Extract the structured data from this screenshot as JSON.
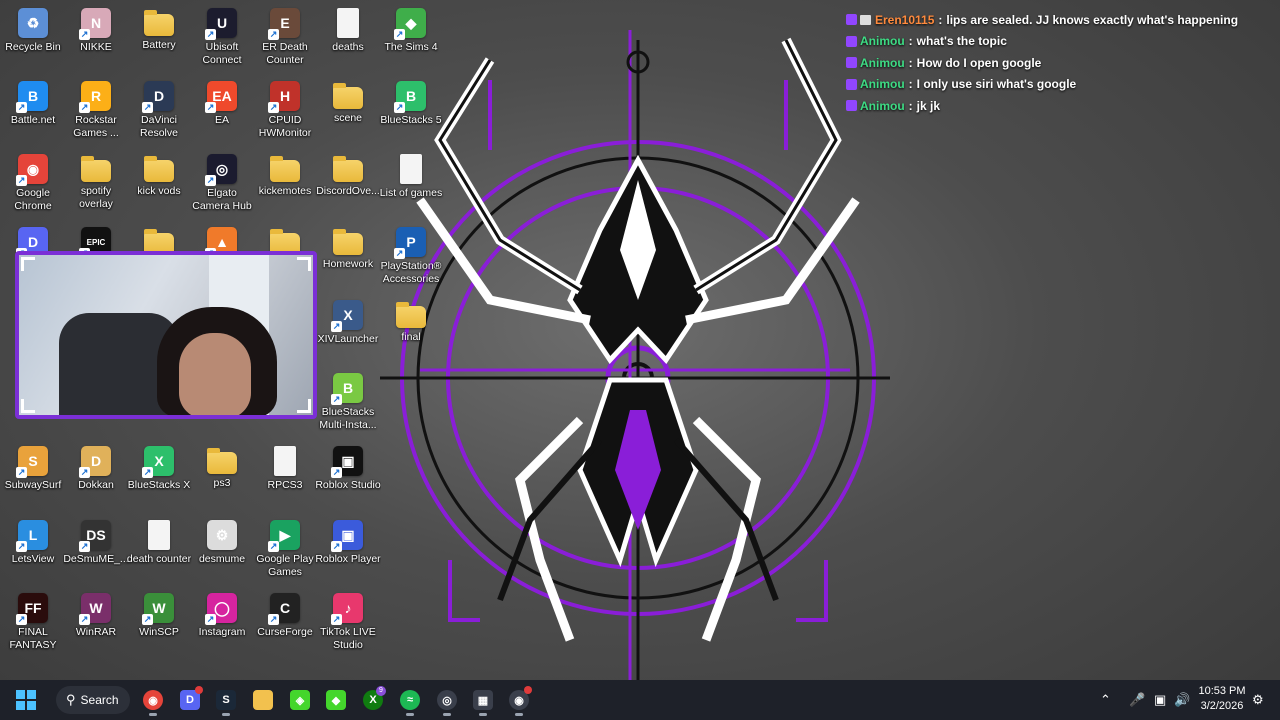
{
  "desktop_icons": [
    {
      "label": "Recycle Bin",
      "icon": "recycle-bin-icon"
    },
    {
      "label": "NIKKE",
      "icon": "nikke-icon"
    },
    {
      "label": "Battery",
      "icon": "folder-icon"
    },
    {
      "label": "Ubisoft Connect",
      "icon": "ubisoft-icon"
    },
    {
      "label": "ER Death Counter",
      "icon": "er-death-counter-icon"
    },
    {
      "label": "deaths",
      "icon": "document-icon"
    },
    {
      "label": "The Sims 4",
      "icon": "sims-icon"
    },
    {
      "label": "Battle.net",
      "icon": "battlenet-icon"
    },
    {
      "label": "Rockstar Games ...",
      "icon": "rockstar-icon"
    },
    {
      "label": "DaVinci Resolve",
      "icon": "davinci-icon"
    },
    {
      "label": "EA",
      "icon": "ea-icon"
    },
    {
      "label": "CPUID HWMonitor",
      "icon": "hwmonitor-icon"
    },
    {
      "label": "scene",
      "icon": "folder-icon"
    },
    {
      "label": "BlueStacks 5",
      "icon": "bluestacks-icon"
    },
    {
      "label": "Google Chrome",
      "icon": "chrome-icon"
    },
    {
      "label": "spotify overlay",
      "icon": "folder-icon"
    },
    {
      "label": "kick vods",
      "icon": "folder-icon"
    },
    {
      "label": "Elgato Camera Hub",
      "icon": "elgato-icon"
    },
    {
      "label": "kickemotes",
      "icon": "folder-icon"
    },
    {
      "label": "DiscordOve...",
      "icon": "folder-icon"
    },
    {
      "label": "List of games",
      "icon": "document-icon"
    },
    {
      "label": "",
      "icon": "discord-icon"
    },
    {
      "label": "",
      "icon": "epic-games-icon"
    },
    {
      "label": "",
      "icon": "folder-icon"
    },
    {
      "label": "",
      "icon": "app-icon"
    },
    {
      "label": "",
      "icon": "folder-icon"
    },
    {
      "label": "Homework",
      "icon": "folder-icon"
    },
    {
      "label": "PlayStation® Accessories",
      "icon": "playstation-icon"
    },
    {
      "label": "XIVLauncher",
      "icon": "xivlauncher-icon"
    },
    {
      "label": "final",
      "icon": "folder-icon"
    },
    {
      "label": "BlueStacks Multi-Insta...",
      "icon": "bluestacks-multi-icon"
    },
    {
      "label": "SubwaySurf",
      "icon": "subway-surfers-icon"
    },
    {
      "label": "Dokkan",
      "icon": "dokkan-icon"
    },
    {
      "label": "BlueStacks X",
      "icon": "bluestacks-x-icon"
    },
    {
      "label": "ps3",
      "icon": "folder-icon"
    },
    {
      "label": "RPCS3",
      "icon": "document-icon"
    },
    {
      "label": "Roblox Studio",
      "icon": "roblox-studio-icon"
    },
    {
      "label": "LetsView",
      "icon": "letsview-icon"
    },
    {
      "label": "DeSmuME_...",
      "icon": "desmume-app-icon"
    },
    {
      "label": "death counter",
      "icon": "document-icon"
    },
    {
      "label": "desmume",
      "icon": "settings-file-icon"
    },
    {
      "label": "Google Play Games",
      "icon": "google-play-games-icon"
    },
    {
      "label": "Roblox Player",
      "icon": "roblox-player-icon"
    },
    {
      "label": "FINAL FANTASY XI...",
      "icon": "final-fantasy-icon"
    },
    {
      "label": "WinRAR",
      "icon": "winrar-icon"
    },
    {
      "label": "WinSCP",
      "icon": "winscp-icon"
    },
    {
      "label": "Instagram",
      "icon": "instagram-icon"
    },
    {
      "label": "CurseForge",
      "icon": "curseforge-icon"
    },
    {
      "label": "TikTok LIVE Studio",
      "icon": "tiktok-live-icon"
    }
  ],
  "chat": [
    {
      "user": "Eren10115",
      "user_color": "#ff8a3d",
      "text": "lips are sealed. JJ knows exactly what's happening",
      "extra_badge": true
    },
    {
      "user": "Animou",
      "user_color": "#3ddc84",
      "text": "what's the topic",
      "extra_badge": false
    },
    {
      "user": "Animou",
      "user_color": "#3ddc84",
      "text": "How do I open google",
      "extra_badge": false
    },
    {
      "user": "Animou",
      "user_color": "#3ddc84",
      "text": "I only use siri what's google",
      "extra_badge": false
    },
    {
      "user": "Animou",
      "user_color": "#3ddc84",
      "text": "jk jk",
      "extra_badge": false
    }
  ],
  "chat_separator": ":",
  "taskbar": {
    "search_label": "Search",
    "apps": [
      {
        "icon": "chrome-icon",
        "active": true,
        "badge": false
      },
      {
        "icon": "discord-icon",
        "active": false,
        "badge": true
      },
      {
        "icon": "steam-icon",
        "active": true,
        "badge": false
      },
      {
        "icon": "file-explorer-icon",
        "active": false,
        "badge": false
      },
      {
        "icon": "razer-icon",
        "active": false,
        "badge": false
      },
      {
        "icon": "gamepass-icon",
        "active": false,
        "badge": false
      },
      {
        "icon": "xbox-icon",
        "active": false,
        "badge": true
      },
      {
        "icon": "spotify-icon",
        "active": true,
        "badge": false
      },
      {
        "icon": "camera-hub-icon",
        "active": true,
        "badge": false
      },
      {
        "icon": "streamdeck-icon",
        "active": true,
        "badge": false
      },
      {
        "icon": "obs-icon",
        "active": true,
        "badge": true
      }
    ],
    "xbox_badge_count": "9",
    "time": "10:53 PM",
    "date": "3/2/2026"
  },
  "colors": {
    "accent_purple": "#8a1ed8",
    "taskbar_bg": "#1e2129",
    "user_orange": "#ff8a3d",
    "user_green": "#3ddc84"
  }
}
